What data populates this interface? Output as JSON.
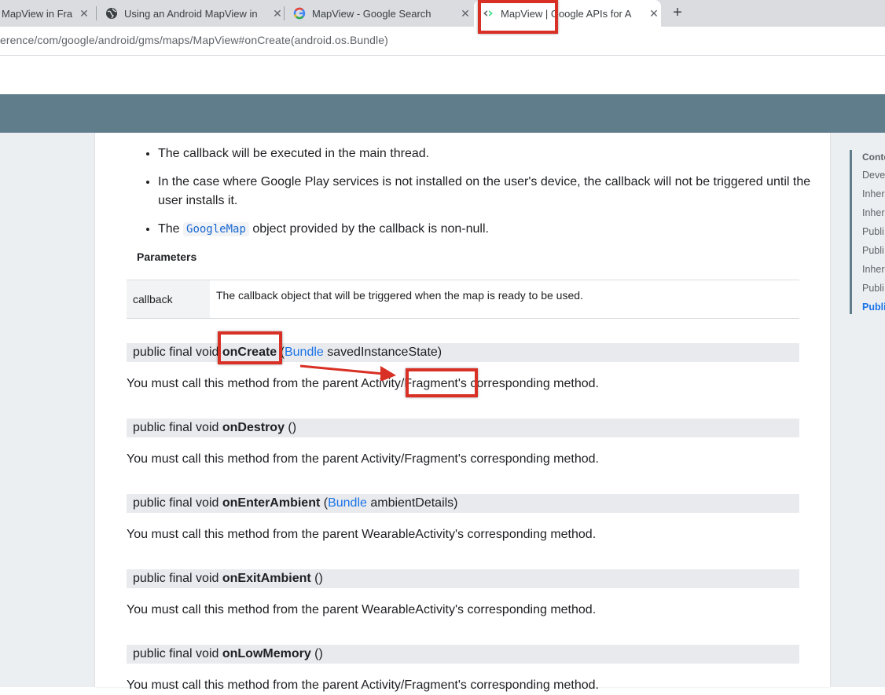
{
  "browser": {
    "tabs": [
      {
        "title": "MapView in Fra",
        "active": false
      },
      {
        "title": "Using an Android MapView in",
        "active": false
      },
      {
        "title": "MapView - Google Search",
        "active": false
      },
      {
        "title": "MapView  |  Google APIs for A",
        "active": true
      }
    ],
    "new_tab": "+",
    "close": "✕",
    "url": "erence/com/google/android/gms/maps/MapView#onCreate(android.os.Bundle)"
  },
  "toc": {
    "items": [
      "Conte",
      "Deve",
      "Inher",
      "Inher",
      "Publi",
      "Publi",
      "Inher",
      "Publi",
      "Publi"
    ]
  },
  "doc": {
    "bullets": {
      "b1": "The callback will be executed in the main thread.",
      "b2": "In the case where Google Play services is not installed on the user's device, the callback will not be triggered until the user installs it.",
      "b3_pre": "The ",
      "b3_code": "GoogleMap",
      "b3_post": " object provided by the callback is non-null."
    },
    "params_label": "Parameters",
    "param": {
      "name": "callback",
      "desc": "The callback object that will be triggered when the map is ready to be used."
    },
    "methods": [
      {
        "prefix": "public final void ",
        "name": "onCreate",
        "open": " (",
        "link": "Bundle",
        "arg": " savedInstanceState)",
        "desc": "You must call this method from the parent Activity/Fragment's corresponding method."
      },
      {
        "prefix": "public final void ",
        "name": "onDestroy",
        "open": " ()",
        "desc": "You must call this method from the parent Activity/Fragment's corresponding method."
      },
      {
        "prefix": "public final void ",
        "name": "onEnterAmbient",
        "open": " (",
        "link": "Bundle",
        "arg": " ambientDetails)",
        "desc": "You must call this method from the parent WearableActivity's corresponding method."
      },
      {
        "prefix": "public final void ",
        "name": "onExitAmbient",
        "open": " ()",
        "desc": "You must call this method from the parent WearableActivity's corresponding method."
      },
      {
        "prefix": "public final void ",
        "name": "onLowMemory",
        "open": " ()",
        "desc": "You must call this method from the parent Activity/Fragment's corresponding method."
      }
    ]
  },
  "colors": {
    "annotation": "#d93025",
    "header": "#607d8b",
    "link": "#1a73e8"
  }
}
